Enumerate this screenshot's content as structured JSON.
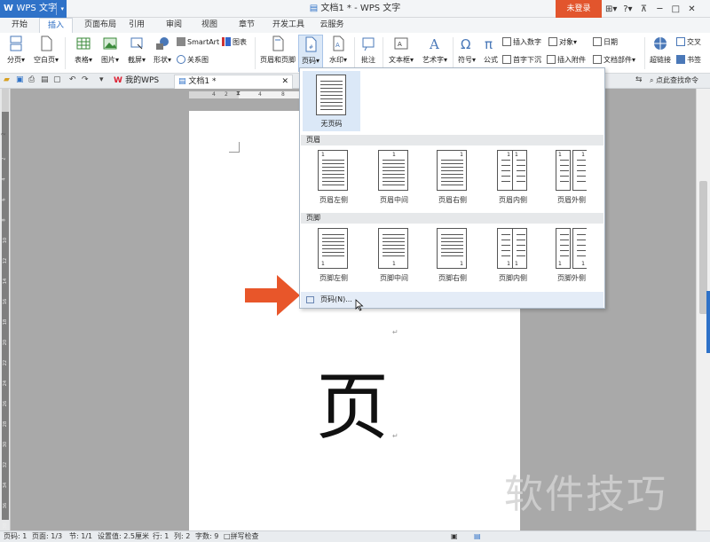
{
  "titlebar": {
    "app_label": "WPS 文字",
    "doc_title": "文档1 * - WPS 文字",
    "login_label": "未登录",
    "icons": [
      "skin-icon",
      "help-icon",
      "minimize-to-tray-icon",
      "minimize-icon",
      "maximize-icon",
      "close-icon"
    ]
  },
  "menu_tabs": [
    "开始",
    "插入",
    "页面布局",
    "引用",
    "审阅",
    "视图",
    "章节",
    "开发工具",
    "云服务"
  ],
  "active_tab": "插入",
  "ribbon": {
    "page_break": "分页",
    "blank_page": "空白页",
    "table": "表格",
    "picture": "图片",
    "screenshot": "截屏",
    "shape": "形状",
    "smartart": "SmartArt",
    "chart": "图表",
    "relation_chart": "关系图",
    "header_footer": "页眉和页脚",
    "page_number": "页码",
    "watermark": "水印",
    "comment": "批注",
    "textbox": "文本框",
    "wordart": "艺术字",
    "symbol": "符号",
    "formula": "公式",
    "insert_number": "插入数字",
    "object": "对象",
    "date": "日期",
    "drop_cap": "首字下沉",
    "attachment": "插入附件",
    "doc_parts": "文档部件",
    "hyperlink": "超链接",
    "cross_ref": "交叉",
    "bookmark": "书签"
  },
  "tabbar": {
    "my_wps": "我的WPS",
    "doc_tab": "文档1 *",
    "search_cmd": "点此查找命令"
  },
  "dropdown": {
    "no_page_number": "无页码",
    "header_section": "页眉",
    "footer_section": "页脚",
    "header_options": [
      "页眉左侧",
      "页眉中间",
      "页眉右侧",
      "页眉内侧",
      "页眉外侧"
    ],
    "footer_options": [
      "页脚左侧",
      "页脚中间",
      "页脚右侧",
      "页脚内侧",
      "页脚外侧"
    ],
    "page_number_item": "页码(N)...",
    "thumb_digit": "1"
  },
  "document": {
    "big_char": "页",
    "para_mark": "↵"
  },
  "watermark_text": "软件技巧",
  "statusbar": {
    "page_num": "页码: 1",
    "pages": "页面: 1/3",
    "section": "节: 1/1",
    "setting": "设置值: 2.5厘米",
    "row": "行: 1",
    "col": "列: 2",
    "words": "字数: 9",
    "spell": "拼写检查"
  },
  "ruler_top_labels": [
    "4",
    "2",
    "4",
    "8"
  ],
  "ruler_left_labels": [
    "2",
    "2",
    "4",
    "6",
    "8",
    "10",
    "12",
    "14",
    "16",
    "18",
    "20",
    "22",
    "24",
    "26",
    "28",
    "30",
    "32",
    "34",
    "36",
    "38",
    "40"
  ],
  "colors": {
    "accent_blue": "#2f72c8",
    "login_red": "#e2552d",
    "arrow_orange": "#e8562a"
  }
}
